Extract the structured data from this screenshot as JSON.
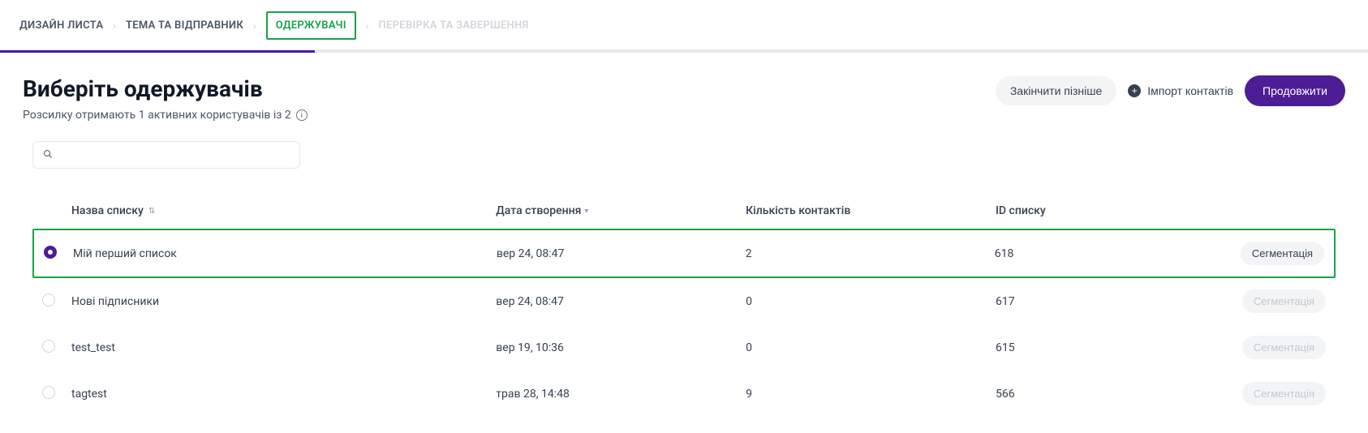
{
  "breadcrumbs": {
    "design": "ДИЗАЙН ЛИСТА",
    "subject": "ТЕМА ТА ВІДПРАВНИК",
    "recipients": "ОДЕРЖУВАЧІ",
    "review": "ПЕРЕВІРКА ТА ЗАВЕРШЕННЯ"
  },
  "header": {
    "title": "Виберіть одержувачів",
    "subtitle": "Розсилку отримають 1 активних користувачів із 2",
    "finish_later": "Закінчити пізніше",
    "import_contacts": "Імпорт контактів",
    "continue": "Продовжити"
  },
  "search": {
    "placeholder": ""
  },
  "table": {
    "headers": {
      "name": "Назва списку",
      "date": "Дата створення",
      "count": "Кількість контактів",
      "id": "ID списку"
    },
    "segmentation_label": "Сегментація",
    "rows": [
      {
        "name": "Мій перший список",
        "date": "вер 24, 08:47",
        "count": "2",
        "id": "618",
        "selected": true,
        "seg_enabled": true
      },
      {
        "name": "Нові підписники",
        "date": "вер 24, 08:47",
        "count": "0",
        "id": "617",
        "selected": false,
        "seg_enabled": false
      },
      {
        "name": "test_test",
        "date": "вер 19, 10:36",
        "count": "0",
        "id": "615",
        "selected": false,
        "seg_enabled": false
      },
      {
        "name": "tagtest",
        "date": "трав 28, 14:48",
        "count": "9",
        "id": "566",
        "selected": false,
        "seg_enabled": false
      }
    ]
  }
}
